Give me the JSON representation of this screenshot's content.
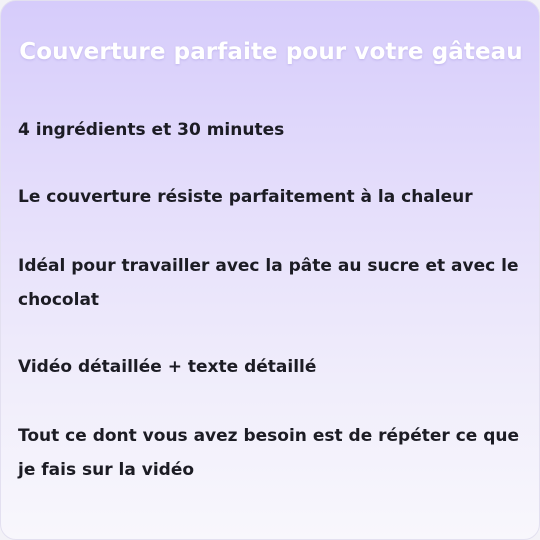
{
  "title": "Couverture parfaite pour votre gâteau",
  "items": [
    "4 ingrédients et 30 minutes",
    "Le couverture résiste parfaitement à la chaleur",
    "Idéal pour travailler avec la pâte au sucre et avec le chocolat",
    "Vidéo détaillée + texte détaillé",
    "Tout ce dont vous avez besoin est de répéter ce que je fais sur la vidéo"
  ]
}
